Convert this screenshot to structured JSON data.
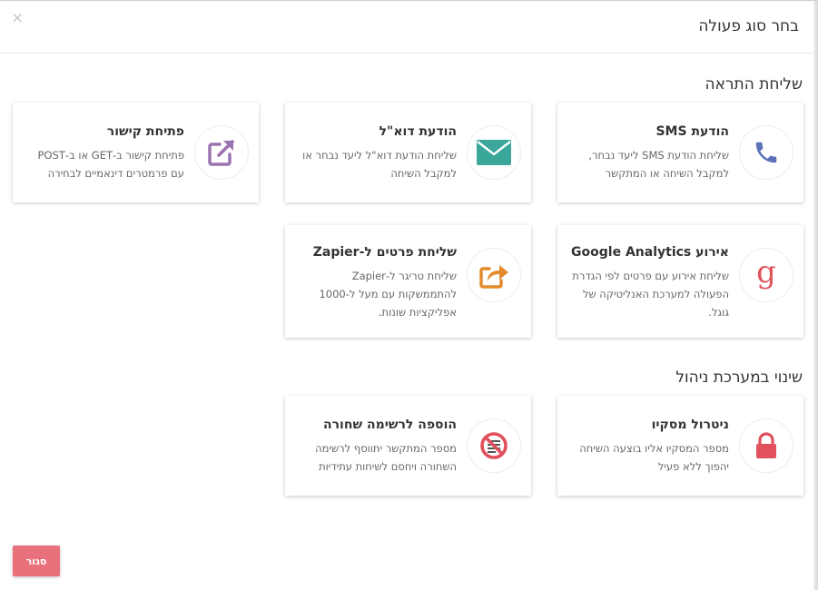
{
  "modal": {
    "title": "בחר סוג פעולה",
    "close_symbol": "×"
  },
  "sections": [
    {
      "title": "שליחת התראה"
    },
    {
      "title": "שינוי במערכת ניהול"
    }
  ],
  "cards": {
    "sms": {
      "title": "הודעת SMS",
      "desc": [
        "שליחת הודעת SMS ליעד נבחר,",
        "למקבל השיחה או המתקשר"
      ],
      "icon": "phone-icon",
      "color": "#5b72b8"
    },
    "email": {
      "title": "הודעת דוא\"ל",
      "desc": [
        "שליחת הודעת דוא\"ל ליעד נבחר או",
        "למקבל השיחה"
      ],
      "icon": "envelope-icon",
      "color": "#3aa79a"
    },
    "link": {
      "title": "פתיחת קישור",
      "desc": [
        "פתיחת קישור ב-GET או ב-POST",
        "עם פרמטרים דינאמיים לבחירה"
      ],
      "icon": "external-link-icon",
      "color": "#9b72b0"
    },
    "analytics": {
      "title": "אירוע Google Analytics",
      "desc": [
        "שליחת אירוע עם פרטים לפי הגדרת",
        "הפעולה למערכת האנליטיקה של",
        "גוגל."
      ],
      "icon": "google-g-icon",
      "color": "#e0555a"
    },
    "zapier": {
      "title": "שליחת פרטים ל-Zapier",
      "desc": [
        "שליחת טריגר ל-Zapier",
        "להתממשקות עם מעל ל-1000",
        "אפליקציות שונות."
      ],
      "icon": "share-icon",
      "color": "#e38a2b"
    },
    "neutralize": {
      "title": "ניטרול מסקיו",
      "desc": [
        "מספר המסקיו אליו בוצעה השיחה",
        "יהפוך ללא פעיל"
      ],
      "icon": "lock-icon",
      "color": "#e0505e"
    },
    "blacklist": {
      "title": "הוספה לרשימה שחורה",
      "desc": [
        "מספר המתקשר יתווסף לרשימה",
        "השחורה ויחסם לשיחות עתידיות"
      ],
      "icon": "blocked-list-icon",
      "color": "#e0505e"
    }
  },
  "footer": {
    "close_label": "סגור"
  }
}
